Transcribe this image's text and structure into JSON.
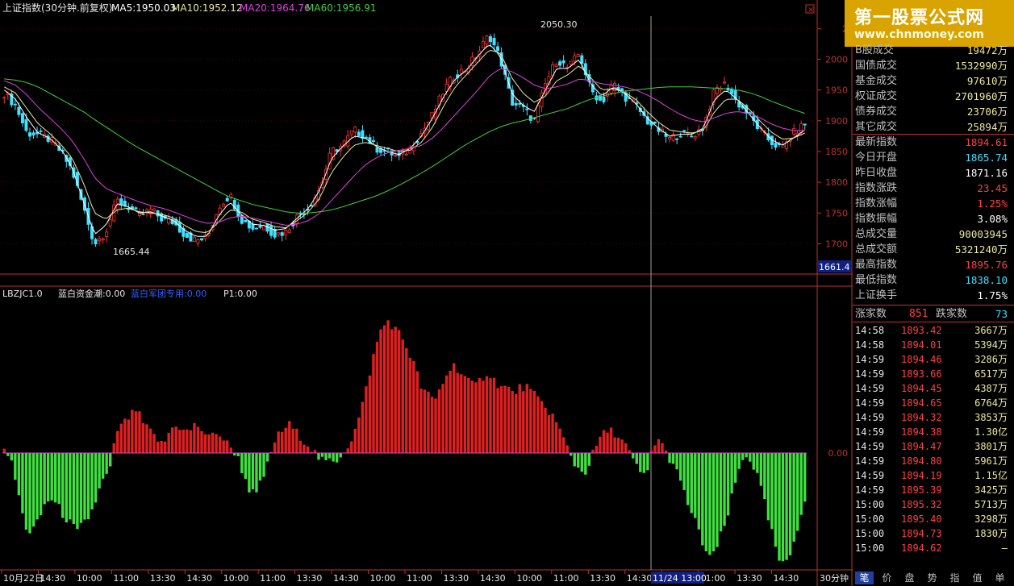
{
  "header": {
    "symbol": "上证指数(30分钟.前复权)",
    "ma5": "MA5:1950.03",
    "ma10": "MA10:1952.12",
    "ma20": "MA20:1964.76",
    "ma60": "MA60:1956.91",
    "close_box": "×"
  },
  "indicator_header": {
    "name": "LBZJC1.0",
    "flow": "蓝白资金潮:0.00",
    "group": "蓝白军团专用:0.00",
    "p1": "P1:0.00"
  },
  "annotations": {
    "high": "2050.30",
    "low": "1665.44",
    "cursor_price": "1661.4",
    "cursor_date": "11/24 13:00"
  },
  "period_label": "30分钟",
  "logo": {
    "line1": "第一股票公式网",
    "line2": "www.chnmoney.com"
  },
  "stats": [
    {
      "label": "B股成交",
      "value": "19472万",
      "color": "#e8e8a0"
    },
    {
      "label": "国债成交",
      "value": "1532990万",
      "color": "#e8e8a0"
    },
    {
      "label": "基金成交",
      "value": "97610万",
      "color": "#e8e8a0"
    },
    {
      "label": "权证成交",
      "value": "2701960万",
      "color": "#e8e8a0"
    },
    {
      "label": "债券成交",
      "value": "23706万",
      "color": "#e8e8a0"
    },
    {
      "label": "其它成交",
      "value": "25894万",
      "color": "#e8e8a0"
    },
    {
      "label": "最新指数",
      "value": "1894.61",
      "color": "#ff4040"
    },
    {
      "label": "今日开盘",
      "value": "1865.74",
      "color": "#40e0ff"
    },
    {
      "label": "昨日收盘",
      "value": "1871.16",
      "color": "#ffffff"
    },
    {
      "label": "指数涨跌",
      "value": "23.45",
      "color": "#ff4040"
    },
    {
      "label": "指数涨幅",
      "value": "1.25%",
      "color": "#ff4040"
    },
    {
      "label": "指数振幅",
      "value": "3.08%",
      "color": "#ffffff"
    },
    {
      "label": "总成交量",
      "value": "90003945",
      "color": "#e8e8a0"
    },
    {
      "label": "总成交额",
      "value": "5321240万",
      "color": "#e8e8a0"
    },
    {
      "label": "最高指数",
      "value": "1895.76",
      "color": "#ff4040"
    },
    {
      "label": "最低指数",
      "value": "1838.10",
      "color": "#40e0ff"
    },
    {
      "label": "上证换手",
      "value": "1.75%",
      "color": "#ffffff"
    }
  ],
  "breadth": {
    "up_label": "涨家数",
    "up_value": "851",
    "down_label": "跌家数",
    "down_value": "73"
  },
  "ticks": [
    {
      "time": "14:58",
      "price": "1893.42",
      "vol": "3667万"
    },
    {
      "time": "14:58",
      "price": "1894.01",
      "vol": "5394万"
    },
    {
      "time": "14:59",
      "price": "1894.46",
      "vol": "3286万"
    },
    {
      "time": "14:59",
      "price": "1893.66",
      "vol": "6517万"
    },
    {
      "time": "14:59",
      "price": "1894.45",
      "vol": "4387万"
    },
    {
      "time": "14:59",
      "price": "1894.65",
      "vol": "6764万"
    },
    {
      "time": "14:59",
      "price": "1894.32",
      "vol": "3853万"
    },
    {
      "time": "14:59",
      "price": "1894.38",
      "vol": "1.30亿"
    },
    {
      "time": "14:59",
      "price": "1894.47",
      "vol": "3801万"
    },
    {
      "time": "14:59",
      "price": "1894.80",
      "vol": "5961万"
    },
    {
      "time": "14:59",
      "price": "1894.19",
      "vol": "1.15亿"
    },
    {
      "time": "14:59",
      "price": "1895.39",
      "vol": "3425万"
    },
    {
      "time": "15:00",
      "price": "1895.32",
      "vol": "5713万"
    },
    {
      "time": "15:00",
      "price": "1895.40",
      "vol": "3298万"
    },
    {
      "time": "15:00",
      "price": "1894.73",
      "vol": "1830万"
    },
    {
      "time": "15:00",
      "price": "1894.62",
      "vol": "—"
    }
  ],
  "tabs": [
    "笔",
    "价",
    "盘",
    "势",
    "指",
    "值",
    "单"
  ],
  "chart_data": [
    {
      "type": "candlestick",
      "title": "上证指数(30分钟.前复权)",
      "ylim": [
        1660,
        2070
      ],
      "yticks": [
        1700,
        1750,
        1800,
        1850,
        1900,
        1950,
        2000,
        2050
      ],
      "ytick_labels": [
        "1700",
        "1750",
        "1800",
        "1850",
        "1900",
        "1950",
        "2000",
        "2"
      ],
      "x_labels": [
        "10月22日",
        "14:30",
        "10:00",
        "11:00",
        "13:30",
        "14:30",
        "10:00",
        "11:00",
        "13:30",
        "14:30",
        "10:00",
        "11:00",
        "13:30",
        "14:30",
        "10:00",
        "11:00",
        "13:30",
        "14:30",
        "10:00",
        "11:00",
        "13:30",
        "14:30"
      ],
      "close_anchors": [
        1945,
        1925,
        1880,
        1878,
        1870,
        1850,
        1820,
        1760,
        1700,
        1720,
        1770,
        1760,
        1745,
        1755,
        1740,
        1735,
        1715,
        1705,
        1710,
        1760,
        1780,
        1740,
        1725,
        1730,
        1715,
        1720,
        1745,
        1760,
        1790,
        1850,
        1860,
        1885,
        1875,
        1855,
        1850,
        1840,
        1855,
        1880,
        1910,
        1950,
        1975,
        1985,
        2010,
        2040,
        2000,
        1930,
        1920,
        1900,
        1960,
        2000,
        1985,
        2010,
        1950,
        1930,
        1960,
        1940,
        1925,
        1900,
        1885,
        1870,
        1880,
        1875,
        1890,
        1950,
        1960,
        1930,
        1910,
        1885,
        1865,
        1855,
        1880,
        1895
      ],
      "ma_series": [
        {
          "name": "MA5",
          "color": "#ffffff",
          "anchors": [
            1950,
            1935,
            1905,
            1880,
            1872,
            1855,
            1825,
            1770,
            1715,
            1730,
            1765,
            1760,
            1750,
            1752,
            1745,
            1738,
            1722,
            1712,
            1712,
            1745,
            1768,
            1748,
            1732,
            1730,
            1722,
            1725,
            1742,
            1758,
            1788,
            1838,
            1858,
            1875,
            1872,
            1858,
            1850,
            1845,
            1855,
            1875,
            1905,
            1940,
            1968,
            1982,
            2005,
            2025,
            2005,
            1945,
            1925,
            1915,
            1950,
            1985,
            1985,
            2000,
            1960,
            1940,
            1955,
            1945,
            1928,
            1905,
            1888,
            1875,
            1878,
            1878,
            1888,
            1935,
            1950,
            1935,
            1912,
            1890,
            1870,
            1860,
            1872,
            1885
          ]
        },
        {
          "name": "MA10",
          "color": "#e8e8a0",
          "anchors": [
            1955,
            1945,
            1920,
            1895,
            1880,
            1862,
            1840,
            1800,
            1750,
            1740,
            1755,
            1758,
            1752,
            1750,
            1748,
            1742,
            1730,
            1720,
            1718,
            1735,
            1755,
            1752,
            1740,
            1735,
            1728,
            1726,
            1738,
            1752,
            1775,
            1815,
            1840,
            1860,
            1865,
            1860,
            1855,
            1850,
            1852,
            1865,
            1890,
            1925,
            1955,
            1975,
            1995,
            2015,
            2010,
            1970,
            1945,
            1930,
            1940,
            1965,
            1975,
            1990,
            1970,
            1950,
            1952,
            1946,
            1935,
            1915,
            1898,
            1885,
            1882,
            1880,
            1884,
            1915,
            1935,
            1935,
            1920,
            1900,
            1882,
            1870,
            1872,
            1880
          ]
        },
        {
          "name": "MA20",
          "color": "#e040e0",
          "anchors": [
            1965,
            1958,
            1942,
            1922,
            1905,
            1888,
            1868,
            1840,
            1808,
            1790,
            1782,
            1775,
            1768,
            1762,
            1758,
            1752,
            1745,
            1738,
            1733,
            1735,
            1742,
            1745,
            1742,
            1738,
            1734,
            1730,
            1732,
            1738,
            1750,
            1770,
            1790,
            1810,
            1828,
            1840,
            1848,
            1852,
            1855,
            1860,
            1872,
            1890,
            1910,
            1930,
            1950,
            1972,
            1985,
            1980,
            1970,
            1958,
            1952,
            1955,
            1960,
            1968,
            1965,
            1960,
            1958,
            1955,
            1950,
            1942,
            1932,
            1920,
            1910,
            1902,
            1898,
            1905,
            1912,
            1915,
            1912,
            1905,
            1895,
            1888,
            1884,
            1884
          ]
        },
        {
          "name": "MA60",
          "color": "#40d040",
          "anchors": [
            1968,
            1966,
            1962,
            1955,
            1945,
            1935,
            1925,
            1915,
            1902,
            1890,
            1878,
            1866,
            1855,
            1845,
            1835,
            1825,
            1815,
            1805,
            1795,
            1785,
            1776,
            1770,
            1764,
            1760,
            1756,
            1752,
            1750,
            1750,
            1752,
            1755,
            1760,
            1766,
            1772,
            1778,
            1786,
            1795,
            1805,
            1815,
            1826,
            1838,
            1850,
            1862,
            1872,
            1882,
            1890,
            1896,
            1900,
            1905,
            1910,
            1915,
            1920,
            1928,
            1935,
            1940,
            1944,
            1948,
            1950,
            1952,
            1954,
            1955,
            1955,
            1955,
            1954,
            1953,
            1952,
            1950,
            1946,
            1940,
            1932,
            1925,
            1918,
            1912
          ]
        }
      ]
    },
    {
      "type": "bar",
      "title": "LBZJC1.0",
      "ylim": [
        -13,
        20
      ],
      "yticks": [
        0
      ],
      "ytick_labels": [
        "0.00"
      ],
      "value_anchors": [
        1,
        -1,
        -4,
        -8,
        -9,
        -8,
        -6,
        -5,
        -6,
        -7,
        -8,
        -9,
        -8,
        -7,
        -5,
        -3,
        -2,
        3,
        4,
        5,
        6,
        4,
        3,
        2,
        1,
        3,
        4,
        3,
        3,
        4,
        3,
        2,
        3,
        2,
        1,
        0,
        -2,
        -4,
        -5,
        -3,
        -1,
        2,
        3,
        4,
        3,
        2,
        1,
        0,
        -1,
        -1,
        -1,
        0,
        1,
        3,
        6,
        10,
        14,
        17,
        18,
        17,
        16,
        14,
        12,
        9,
        8,
        7,
        9,
        11,
        12,
        11,
        10,
        9,
        10,
        11,
        10,
        9,
        9,
        8,
        9,
        9,
        8,
        7,
        6,
        5,
        3,
        1,
        -1,
        -2,
        -2,
        0,
        2,
        3,
        3,
        2,
        1,
        -1,
        -2,
        -3,
        1,
        2,
        0,
        -1,
        -3,
        -5,
        -7,
        -9,
        -11,
        -12,
        -10,
        -8,
        -5,
        -2,
        0,
        -1,
        -3,
        -6,
        -9,
        -12,
        -13,
        -11,
        -8,
        -5
      ]
    }
  ]
}
